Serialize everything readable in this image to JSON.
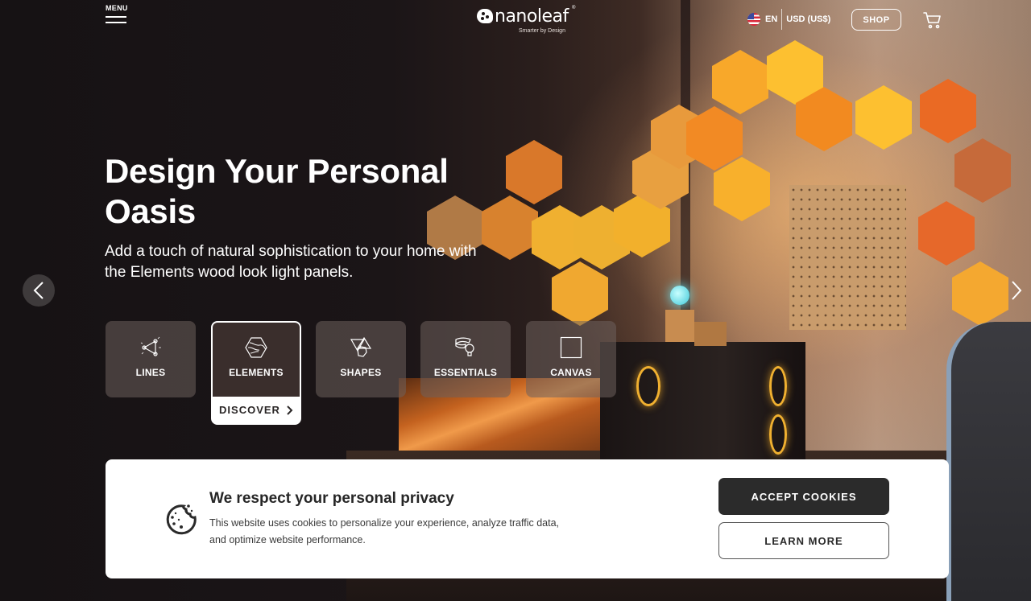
{
  "header": {
    "menu_label": "MENU",
    "logo": {
      "brand": "nanoleaf",
      "tagline": "Smarter by Design",
      "registered": "®"
    },
    "language": {
      "flag": "us-flag-icon",
      "code": "EN"
    },
    "currency": "USD (US$)",
    "shop_label": "SHOP",
    "cart_icon": "shopping-cart-icon"
  },
  "hero": {
    "title": "Design Your Personal Oasis",
    "subtitle": "Add a touch of natural sophistication to your home with the Elements wood look light panels.",
    "prev_icon": "chevron-left-icon",
    "next_icon": "chevron-right-icon"
  },
  "product_tiles": [
    {
      "label": "LINES",
      "icon": "lines-triangle-icon",
      "active": false
    },
    {
      "label": "ELEMENTS",
      "icon": "wood-hexagon-icon",
      "active": true,
      "cta": "DISCOVER"
    },
    {
      "label": "SHAPES",
      "icon": "shapes-icon",
      "active": false
    },
    {
      "label": "ESSENTIALS",
      "icon": "lightstrip-bulb-icon",
      "active": false
    },
    {
      "label": "CANVAS",
      "icon": "square-icon",
      "active": false
    }
  ],
  "cookie_banner": {
    "icon": "cookie-icon",
    "title": "We respect your personal privacy",
    "text": "This website uses cookies to personalize your experience, analyze traffic data, and optimize website performance.",
    "accept_label": "ACCEPT COOKIES",
    "learn_label": "LEARN MORE"
  },
  "colors": {
    "background_dark": "#161214",
    "accent_panel": "#f5a623",
    "button_dark": "#2b2b2b",
    "banner_bg": "#ffffff"
  }
}
